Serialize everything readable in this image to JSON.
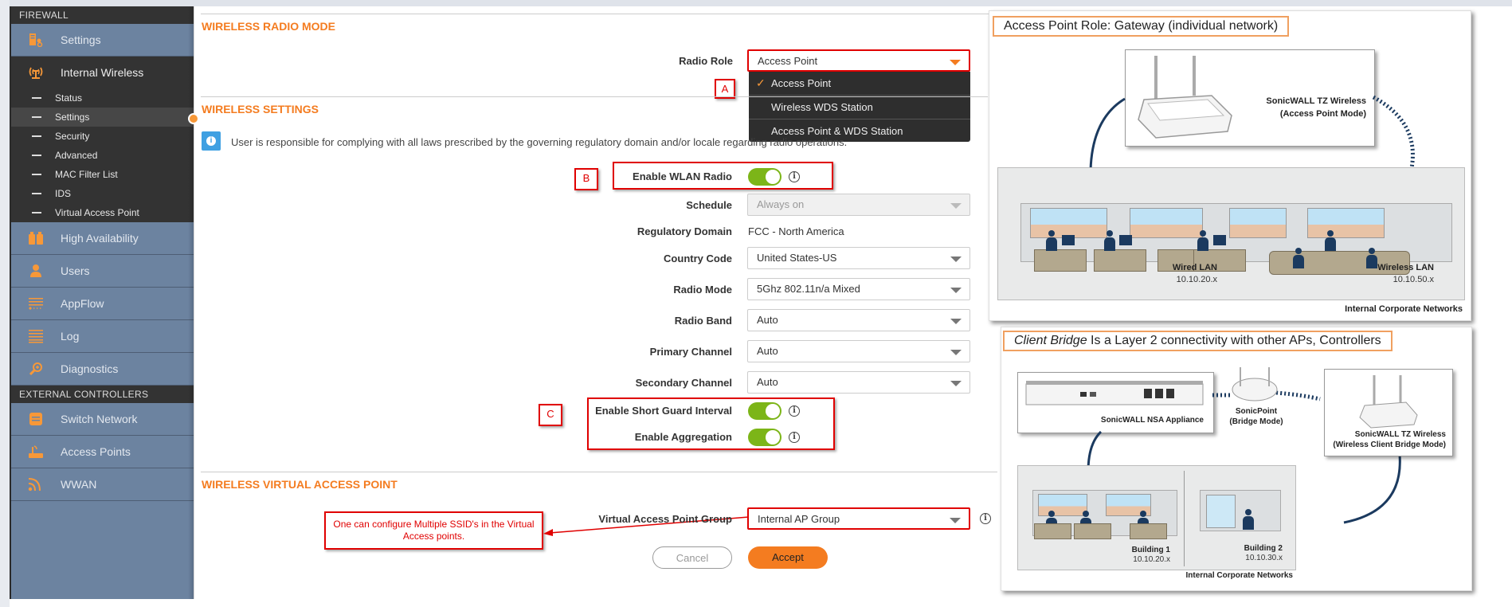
{
  "sidebar": {
    "section_firewall": "FIREWALL",
    "items": [
      {
        "label": "Settings",
        "icon": "server-settings-icon"
      },
      {
        "label": "Internal Wireless",
        "icon": "wireless-tower-icon"
      }
    ],
    "sub_items": [
      {
        "label": "Status"
      },
      {
        "label": "Settings",
        "active": true
      },
      {
        "label": "Security"
      },
      {
        "label": "Advanced"
      },
      {
        "label": "MAC Filter List"
      },
      {
        "label": "IDS"
      },
      {
        "label": "Virtual Access Point"
      }
    ],
    "items_after": [
      {
        "label": "High Availability",
        "icon": "high-availability-icon"
      },
      {
        "label": "Users",
        "icon": "user-icon"
      },
      {
        "label": "AppFlow",
        "icon": "appflow-icon"
      },
      {
        "label": "Log",
        "icon": "log-icon"
      },
      {
        "label": "Diagnostics",
        "icon": "diagnostics-icon"
      }
    ],
    "section_external": "EXTERNAL CONTROLLERS",
    "external_items": [
      {
        "label": "Switch Network",
        "icon": "switch-network-icon"
      },
      {
        "label": "Access Points",
        "icon": "access-point-icon"
      },
      {
        "label": "WWAN",
        "icon": "wwan-icon"
      }
    ]
  },
  "main": {
    "radio_mode": {
      "title": "WIRELESS RADIO MODE",
      "radio_role_label": "Radio Role",
      "radio_role_value": "Access Point",
      "radio_role_options": [
        "Access Point",
        "Wireless WDS Station",
        "Access Point & WDS Station"
      ],
      "selected_option": "Access Point"
    },
    "wireless_settings": {
      "title": "WIRELESS SETTINGS",
      "notice": "User is responsible for complying with all laws prescribed by the governing regulatory domain and/or locale regarding radio operations.",
      "enable_wlan_label": "Enable WLAN Radio",
      "enable_wlan_on": true,
      "schedule_label": "Schedule",
      "schedule_value": "Always on",
      "regulatory_domain_label": "Regulatory Domain",
      "regulatory_domain_value": "FCC - North America",
      "country_code_label": "Country Code",
      "country_code_value": "United States-US",
      "radio_mode_label": "Radio Mode",
      "radio_mode_value": "5Ghz 802.11n/a Mixed",
      "radio_band_label": "Radio Band",
      "radio_band_value": "Auto",
      "primary_channel_label": "Primary Channel",
      "primary_channel_value": "Auto",
      "secondary_channel_label": "Secondary Channel",
      "secondary_channel_value": "Auto",
      "short_guard_label": "Enable Short Guard Interval",
      "short_guard_on": true,
      "aggregation_label": "Enable Aggregation",
      "aggregation_on": true
    },
    "vap": {
      "title": "WIRELESS VIRTUAL ACCESS POINT",
      "group_label": "Virtual Access Point Group",
      "group_value": "Internal AP Group"
    },
    "buttons": {
      "cancel": "Cancel",
      "accept": "Accept"
    }
  },
  "annotations": {
    "marker_a": "A",
    "marker_b": "B",
    "marker_c": "C",
    "callout": "One can configure Multiple SSID's in the Virtual Access points."
  },
  "diagram_gateway": {
    "title": "Access Point Role:  Gateway (individual network)",
    "device_name": "SonicWALL TZ Wireless",
    "device_mode": "(Access Point Mode)",
    "wired_label": "Wired LAN",
    "wired_subnet": "10.10.20.x",
    "wireless_label": "Wireless LAN",
    "wireless_subnet": "10.10.50.x",
    "footer": "Internal Corporate Networks"
  },
  "diagram_bridge": {
    "title_italic": "Client Bridge",
    "title_rest": " Is a Layer 2 connectivity with other APs, Controllers",
    "appliance": "SonicWALL NSA Appliance",
    "sonicpoint": "SonicPoint",
    "sonicpoint_mode": "(Bridge Mode)",
    "tz_name": "SonicWALL TZ Wireless",
    "tz_mode": "(Wireless Client Bridge Mode)",
    "building1": "Building 1",
    "building1_subnet": "10.10.20.x",
    "building2": "Building 2",
    "building2_subnet": "10.10.30.x",
    "footer": "Internal Corporate Networks"
  },
  "colors": {
    "accent": "#f47c20",
    "toggle_on": "#7cb518",
    "sidebar_bg": "#6c83a0",
    "annotation_red": "#e00000"
  }
}
